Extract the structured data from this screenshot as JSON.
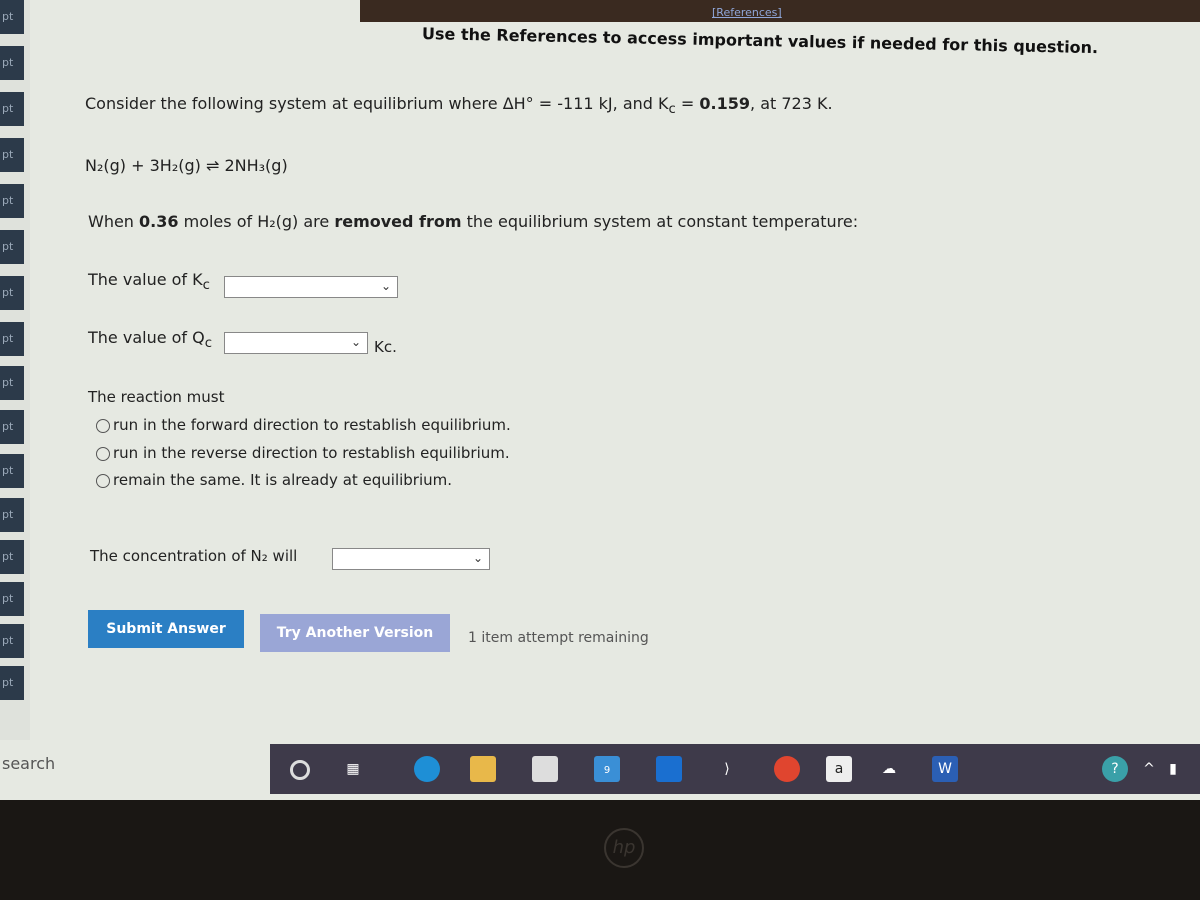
{
  "header": {
    "references_link": "[References]",
    "instruction": "Use the References to access important values if needed for this question."
  },
  "sidebar": {
    "items": [
      "pt",
      "pt",
      "pt",
      "pt",
      "pt",
      "pt",
      "pt",
      "pt",
      "pt",
      "pt",
      "pt",
      "pt",
      "pt",
      "pt",
      "pt",
      "pt"
    ]
  },
  "question": {
    "intro_prefix": "Consider the following system at equilibrium where ΔH° = ",
    "delta_h": "-111 kJ",
    "intro_mid": ", and K",
    "kc_sub": "c",
    "kc_eq": " = ",
    "kc_value": "0.159",
    "intro_suffix": ", at 723 K.",
    "reaction": "N₂(g) + 3H₂(g) ⇌ 2NH₃(g)",
    "change_prefix": "When ",
    "change_amount": "0.36",
    "change_mid": " moles of H₂(g) are ",
    "change_action": "removed from",
    "change_suffix": " the equilibrium system at constant temperature:",
    "kc_label": "The value of K",
    "kc_label_sub": "c",
    "kc_select": "",
    "qc_label": "The value of Q",
    "qc_label_sub": "c",
    "qc_select": "",
    "qc_suffix": "Kc.",
    "reaction_must": "The reaction must",
    "options": [
      "run in the forward direction to restablish equilibrium.",
      "run in the reverse direction to restablish equilibrium.",
      "remain the same.  It is already at equilibrium."
    ],
    "conc_label": "The concentration of N₂ will",
    "conc_select": ""
  },
  "actions": {
    "submit": "Submit Answer",
    "try_another": "Try Another Version",
    "attempts": "1 item attempt remaining"
  },
  "taskbar": {
    "search": "search",
    "mail_badge": "9",
    "amazon": "a",
    "word": "W"
  },
  "colors": {
    "submit": "#2b7fc4",
    "try_another": "#9aa6d6",
    "taskbar": "#3e3a4a"
  }
}
